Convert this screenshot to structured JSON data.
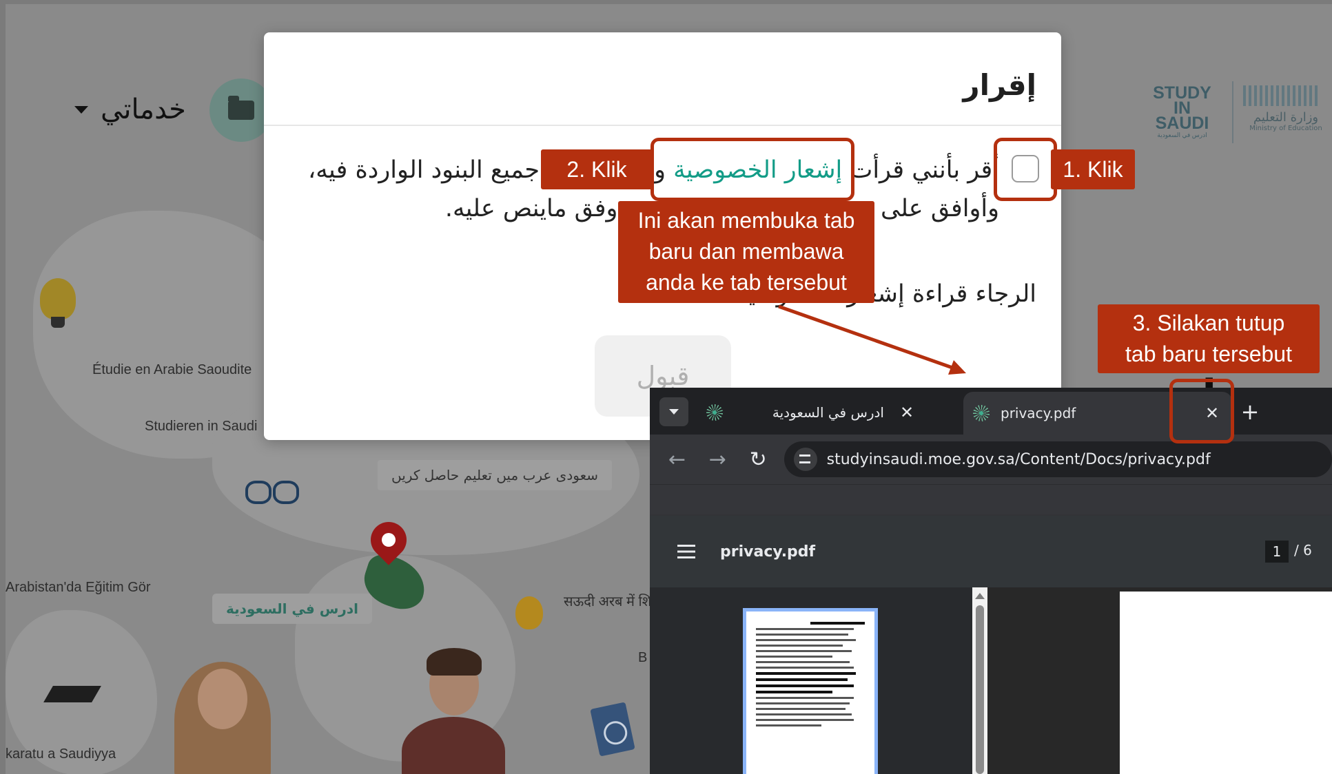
{
  "background": {
    "services_label": "خدماتي",
    "logo_study": {
      "line1": "STUDY",
      "line2": "IN",
      "line3": "SAUDI",
      "sub": "ادرس في السعودية"
    },
    "logo_moe": {
      "ar": "وزارة التعليم",
      "en": "Ministry of Education"
    },
    "map_labels": {
      "french": "Étudie en Arabie Saoudite",
      "german": "Studieren in Saudi",
      "turkish": "Arabistan'da Eğitim Gör",
      "hausa": "karatu a Saudiyya",
      "arabic_pill": "ادرس في السعودية",
      "mirrored_pill": "سعودی عرب میں تعلیم حاصل کریں",
      "hindi": "सऊदी अरब में शि",
      "fragment_b": "B"
    }
  },
  "modal": {
    "title": "إقرار",
    "consent_before": "أقر بأنني قرأت ",
    "privacy_link": "إشعار الخصوصية",
    "consent_after": " وأوافق على جميع البنود الواردة فيه، وأوافق على مشاركة بياناتي الشخصية وفق ماينص عليه.",
    "please_read": "الرجاء قراءة إشعار الخصوصية",
    "accept_label": "قبول"
  },
  "browser": {
    "tab1_title": "ادرس في السعودية",
    "tab2_title": "privacy.pdf",
    "close_glyph": "✕",
    "newtab_glyph": "+",
    "url": "studyinsaudi.moe.gov.sa/Content/Docs/privacy.pdf",
    "pdf_name": "privacy.pdf",
    "page_current": "1",
    "page_total": "/  6",
    "nav_back": "←",
    "nav_forward": "→",
    "nav_reload": "↻"
  },
  "annotations": {
    "step1": "1. Klik",
    "step2": "2. Klik",
    "note_line1": "Ini akan membuka tab",
    "note_line2": "baru dan membawa",
    "note_line3": "anda ke tab tersebut",
    "step3_line1": "3. Silakan tutup",
    "step3_line2": "tab baru tersebut"
  },
  "colors": {
    "callout": "#b4300f",
    "link": "#139c87",
    "browser_dark": "#202124"
  }
}
